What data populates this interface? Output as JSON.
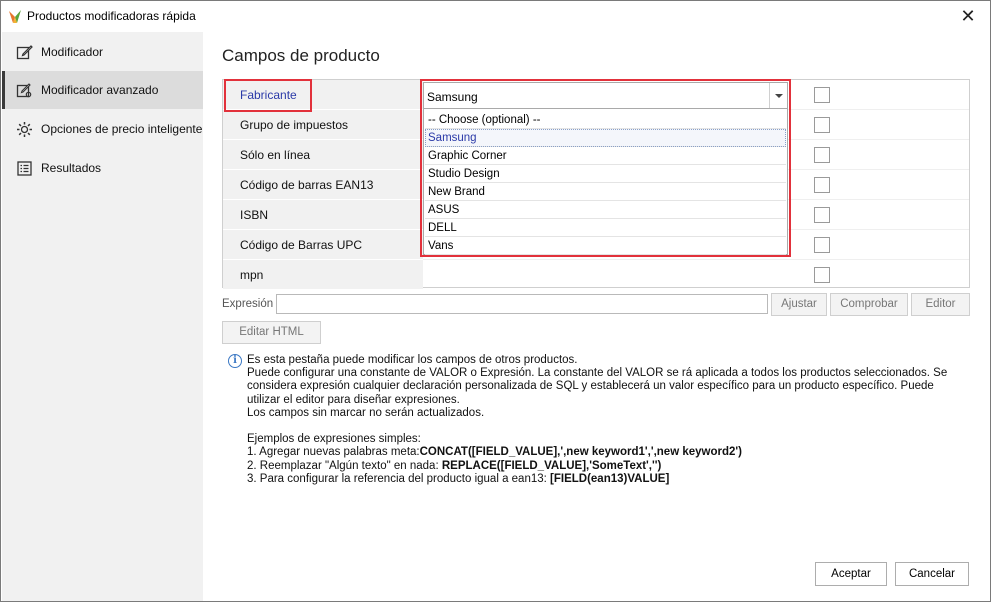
{
  "window": {
    "title": "Productos modificadoras rápida",
    "close_glyph": "✕"
  },
  "sidebar": {
    "items": [
      {
        "label": "Modificador",
        "icon": "edit-icon"
      },
      {
        "label": "Modificador avanzado",
        "icon": "advanced-edit-icon",
        "active": true
      },
      {
        "label": "Opciones de precio inteligente",
        "icon": "price-options-icon"
      },
      {
        "label": "Resultados",
        "icon": "results-icon"
      }
    ]
  },
  "main": {
    "title": "Campos de producto",
    "fields": [
      {
        "label": "Fabricante"
      },
      {
        "label": "Grupo de impuestos"
      },
      {
        "label": "Sólo en línea"
      },
      {
        "label": "Código de barras EAN13"
      },
      {
        "label": "ISBN"
      },
      {
        "label": "Código de Barras UPC"
      },
      {
        "label": "mpn"
      }
    ],
    "manufacturer_combo": {
      "value": "Samsung",
      "options": [
        "-- Choose (optional) --",
        "Samsung",
        "Graphic Corner",
        "Studio Design",
        "New Brand",
        "ASUS",
        "DELL",
        "Vans"
      ],
      "selected_index": 1
    },
    "expression": {
      "label": "Expresión",
      "value": "",
      "adjust_label": "Ajustar",
      "check_label": "Comprobar",
      "editor_label": "Editor"
    },
    "edit_html_label": "Editar HTML",
    "info": {
      "icon": "info-icon",
      "glyph": "i",
      "line1": "Es esta pestaña puede modificar los campos de otros productos.",
      "line2": "Puede configurar una constante de VALOR o Expresión. La constante del VALOR se rá aplicada a todos los productos seleccionados. Se considera expresión cualquier declaración personalizada de SQL y establecerá un valor específico para un producto específico. Puede utilizar el editor para diseñar expresiones.",
      "line3": "Los campos sin marcar no serán actualizados.",
      "examples_title": "Ejemplos de expresiones simples:",
      "ex1_text": "1. Agregar nuevas palabras meta:",
      "ex1_code": "CONCAT([FIELD_VALUE],',new keyword1',',new keyword2')",
      "ex2_text": "2. Reemplazar \"Algún texto\" en nada: ",
      "ex2_code": "REPLACE([FIELD_VALUE],'SomeText','')",
      "ex3_text": "3. Para configurar la referencia del producto igual a ean13: ",
      "ex3_code": "[FIELD(ean13)VALUE]"
    }
  },
  "footer": {
    "accept_label": "Aceptar",
    "cancel_label": "Cancelar"
  },
  "colors": {
    "highlight": "#e2313b",
    "accent_text": "#2b3aa8",
    "sidebar_bg": "#f1f1f1"
  }
}
